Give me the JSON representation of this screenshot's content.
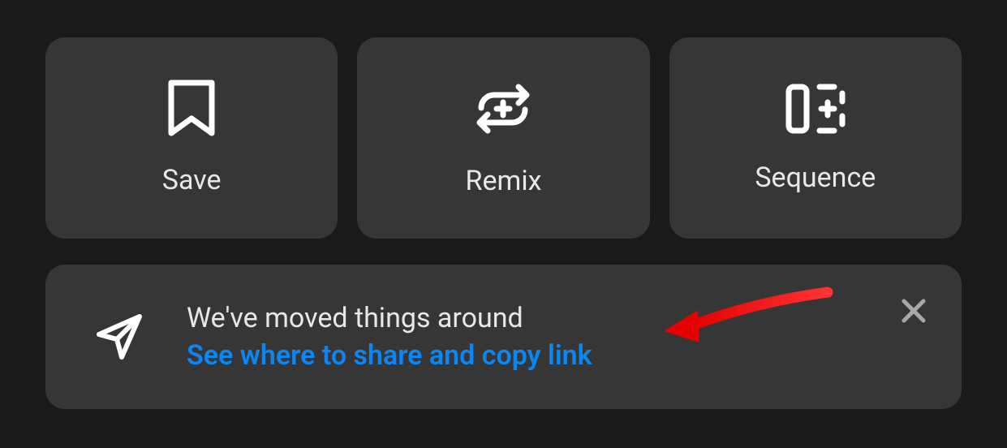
{
  "actions": {
    "save": {
      "label": "Save"
    },
    "remix": {
      "label": "Remix"
    },
    "sequence": {
      "label": "Sequence"
    }
  },
  "banner": {
    "title": "We've moved things around",
    "link": "See where to share and copy link"
  }
}
